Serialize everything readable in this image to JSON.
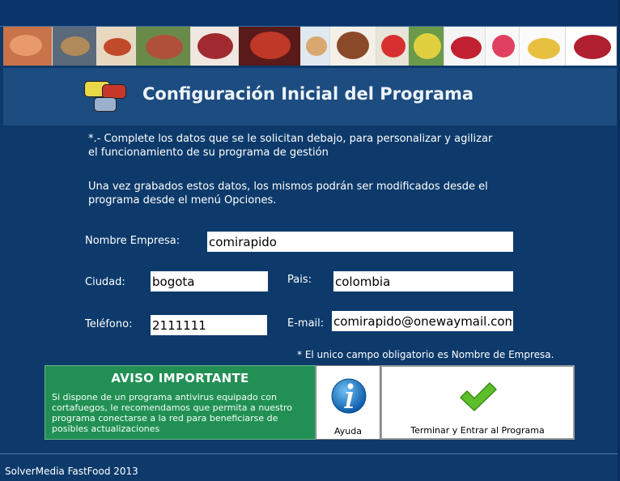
{
  "header": {
    "title": "Configuración Inicial del Programa"
  },
  "intro": {
    "line1": "*.- Complete los datos que se le solicitan debajo, para personalizar y agilizar\nel funcionamiento de su programa de gestión",
    "line2": "     Una vez grabados estos datos, los mismos podrán ser modificados desde el\nprograma desde el menú Opciones."
  },
  "form": {
    "empresa_label": "Nombre Empresa:",
    "empresa_value": "comirapido",
    "ciudad_label": "Ciudad:",
    "ciudad_value": "bogota",
    "pais_label": "Pais:",
    "pais_value": "colombia",
    "telefono_label": "Teléfono:",
    "telefono_value": "2111111",
    "email_label": "E-mail:",
    "email_value": "comirapido@onewaymail.com",
    "note": "* El unico campo obligatorio es Nombre de Empresa."
  },
  "aviso": {
    "title": "AVISO IMPORTANTE",
    "body": "Si dispone de un programa antivirus equipado con cortafuegos, le recomendamos que permita a nuestro programa conectarse a la red para beneficiarse de posibles actualizaciones"
  },
  "buttons": {
    "ayuda": "Ayuda",
    "terminar": "Terminar y Entrar al Programa"
  },
  "footer": {
    "text": "SolverMedia FastFood 2013"
  },
  "colors": {
    "background": "#0d3a6b",
    "header": "#1c4c80",
    "aviso": "#229055"
  }
}
